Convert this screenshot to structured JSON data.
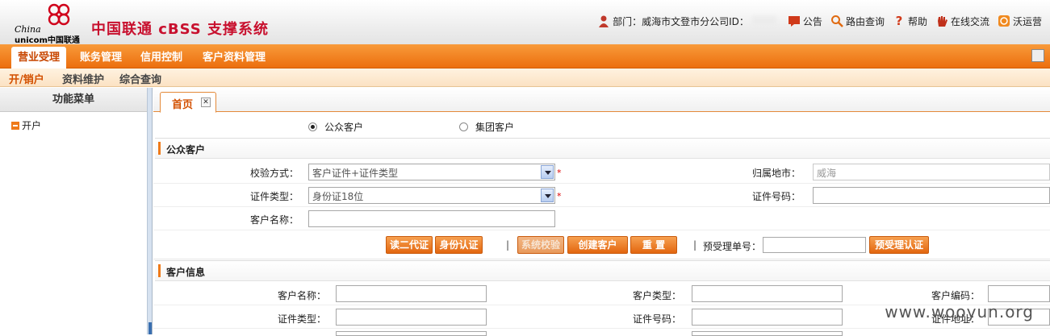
{
  "header": {
    "logo_china": "China",
    "logo_unicom": "unicom中国联通",
    "system_title": "中国联通 cBSS 支撑系统",
    "department_label": "部门：威海市文登市分公司ID：",
    "links": [
      "公告",
      "路由查询",
      "帮助",
      "在线交流",
      "沃运营"
    ]
  },
  "main_nav": [
    "营业受理",
    "账务管理",
    "信用控制",
    "客户资料管理"
  ],
  "sub_nav": [
    "开/销户",
    "资料维护",
    "综合查询"
  ],
  "left_menu": {
    "title": "功能菜单",
    "items": [
      "开户"
    ]
  },
  "page_tab": "首页",
  "customer_type": {
    "options": [
      "公众客户",
      "集团客户"
    ],
    "selected": "公众客户"
  },
  "public_section": {
    "title": "公众客户",
    "verify_label": "校验方式：",
    "verify_value": "客户证件+证件类型",
    "region_label": "归属地市：",
    "region_value": "威海",
    "idtype_label": "证件类型：",
    "idtype_value": "身份证18位",
    "idnum_label": "证件号码：",
    "idnum_value": "",
    "name_label": "客户名称：",
    "name_value": "",
    "required_mark": "*"
  },
  "buttons": {
    "read_id": "读二代证",
    "id_auth": "身份认证",
    "sys_check": "系统校验",
    "create": "创建客户",
    "reset": "重 置",
    "separator": "|",
    "pre_order_label": "预受理单号：",
    "pre_order_value": "",
    "pre_auth": "预受理认证"
  },
  "customer_info": {
    "title": "客户信息",
    "name_label": "客户名称：",
    "type_label": "客户类型：",
    "code_label": "客户编码：",
    "idtype_label": "证件类型：",
    "idnum_label": "证件号码：",
    "address_label": "证件地址："
  },
  "watermark": "www.wooyun.org",
  "colors": {
    "brand_red": "#c8102e",
    "nav_orange": "#ec6f0e",
    "accent_orange": "#ef7a1a"
  }
}
